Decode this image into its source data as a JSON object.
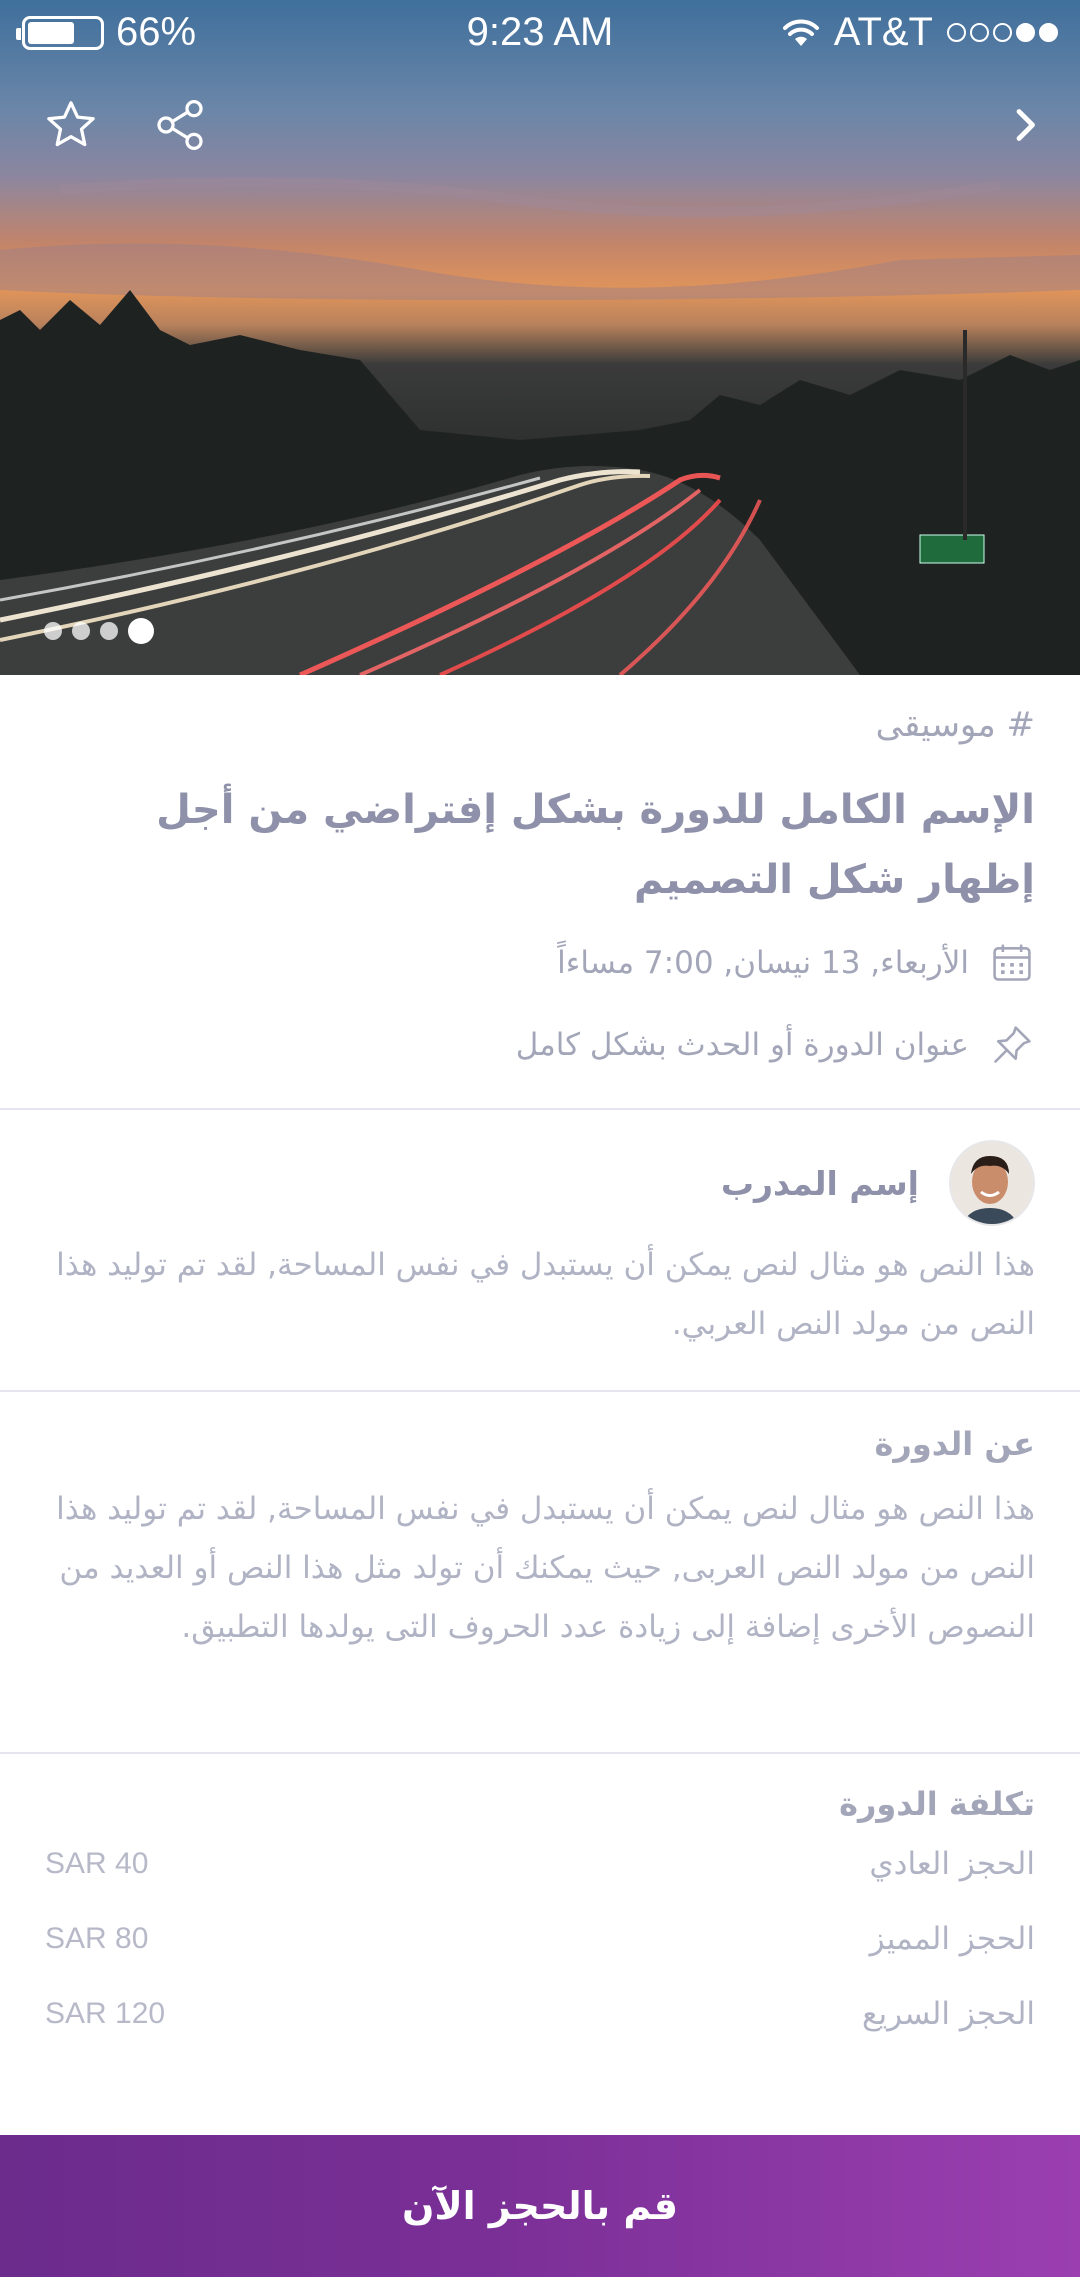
{
  "status_bar": {
    "battery_percent": "66%",
    "battery_level": 0.66,
    "time": "9:23 AM",
    "carrier": "AT&T",
    "signal_strength": 2
  },
  "hero": {
    "image_dots": 4,
    "active_dot": 4,
    "icons": [
      "star-icon",
      "share-icon",
      "chevron-right-icon"
    ]
  },
  "course": {
    "tag": "# موسيقى",
    "title": "الإسم الكامل للدورة بشكل إفتراضي من أجل إظهار شكل التصميم",
    "datetime": "الأربعاء, 13 نيسان, 7:00 مساءاً",
    "location": "عنوان الدورة أو الحدث بشكل كامل"
  },
  "trainer": {
    "name": "إسم المدرب",
    "bio": "هذا النص هو مثال لنص يمكن أن يستبدل في نفس المساحة, لقد تم توليد هذا النص من مولد النص العربي."
  },
  "about": {
    "heading": "عن الدورة",
    "text": "هذا النص هو مثال لنص يمكن أن يستبدل في نفس المساحة, لقد تم توليد هذا النص من مولد النص العربى, حيث يمكنك أن تولد مثل هذا النص أو العديد من النصوص الأخرى إضافة إلى زيادة عدد الحروف التى يولدها التطبيق."
  },
  "cost": {
    "heading": "تكلفة الدورة",
    "items": [
      {
        "label": "الحجز العادي",
        "price": "SAR 40"
      },
      {
        "label": "الحجز المميز",
        "price": "SAR 80"
      },
      {
        "label": "الحجز السريع",
        "price": "SAR 120"
      }
    ]
  },
  "cta": {
    "label": "قم بالحجز الآن"
  },
  "colors": {
    "accent_start": "#6b2c8c",
    "accent_end": "#9b3fb0",
    "title_text": "#8e91a9",
    "muted_text": "#b0b3c4"
  }
}
